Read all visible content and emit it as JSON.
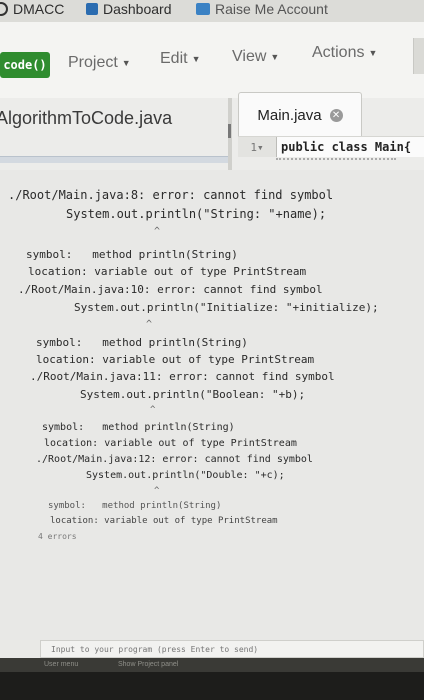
{
  "bookmarks": {
    "items": [
      {
        "label": "DMACC"
      },
      {
        "label": "Dashboard"
      },
      {
        "label": "Raise Me Account"
      }
    ]
  },
  "menubar": {
    "logo": "code()",
    "project": "Project",
    "edit": "Edit",
    "view": "View",
    "actions": "Actions"
  },
  "editor": {
    "left_file": "AlgorithmToCode.java",
    "active_tab": "Main.java",
    "line_number": "1",
    "line_code": "public class Main{"
  },
  "console": {
    "lines": [
      "./Root/Main.java:8: error: cannot find symbol",
      "System.out.println(\"String: \"+name);",
      "^",
      "symbol:   method println(String)",
      "location: variable out of type PrintStream",
      "./Root/Main.java:10: error: cannot find symbol",
      "System.out.println(\"Initialize: \"+initialize);",
      "^",
      "symbol:   method println(String)",
      "location: variable out of type PrintStream",
      "./Root/Main.java:11: error: cannot find symbol",
      "System.out.println(\"Boolean: \"+b);",
      "^",
      "symbol:   method println(String)",
      "location: variable out of type PrintStream",
      "./Root/Main.java:12: error: cannot find symbol",
      "System.out.println(\"Double: \"+c);",
      "^",
      "symbol:   method println(String)",
      "location: variable out of type PrintStream",
      "4 errors"
    ]
  },
  "input": {
    "placeholder": "Input to your program (press Enter to send)"
  },
  "footer": {
    "left": "User menu",
    "right": "Show Project panel"
  }
}
